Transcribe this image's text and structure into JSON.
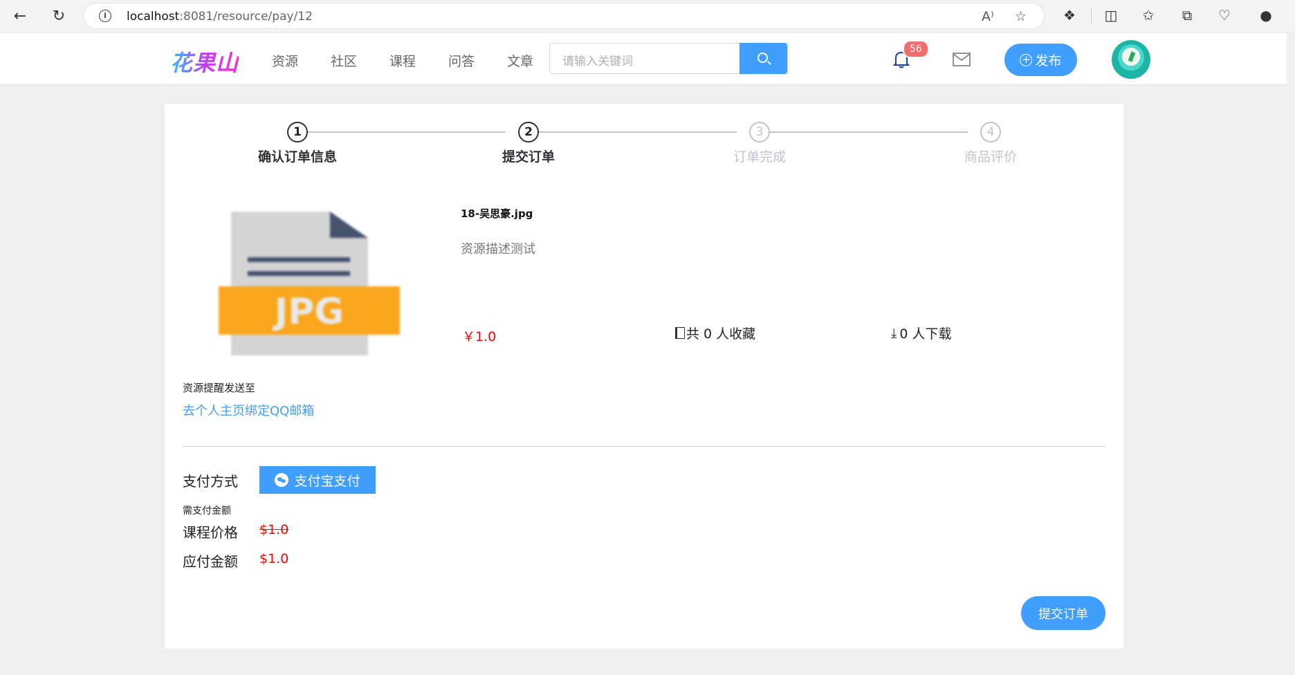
{
  "browser": {
    "url_host": "localhost",
    "url_rest": ":8081/resource/pay/12"
  },
  "header": {
    "logo": "花果山",
    "nav": [
      "资源",
      "社区",
      "课程",
      "问答",
      "文章"
    ],
    "search_placeholder": "请输入关键词",
    "notification_count": "56",
    "publish_label": "发布"
  },
  "steps": [
    {
      "num": "1",
      "label": "确认订单信息",
      "state": "done"
    },
    {
      "num": "2",
      "label": "提交订单",
      "state": "active"
    },
    {
      "num": "3",
      "label": "订单完成",
      "state": "pending"
    },
    {
      "num": "4",
      "label": "商品评价",
      "state": "pending"
    }
  ],
  "resource": {
    "thumb_text": "JPG",
    "title": "18-吴思豪.jpg",
    "description": "资源描述测试",
    "price": "￥1.0",
    "favorites": "共 0 人收藏",
    "downloads": "0 人下载"
  },
  "notify": {
    "label": "资源提醒发送至",
    "bind_link": "去个人主页绑定QQ邮箱"
  },
  "payment": {
    "method_label": "支付方式",
    "method_button": "支付宝支付",
    "need_pay_label": "需支付金额",
    "course_price_label": "课程价格",
    "course_price": "$1.0",
    "payable_label": "应付金额",
    "payable": "$1.0",
    "submit_label": "提交订单"
  },
  "colors": {
    "primary": "#409eff",
    "price_red": "#ff0000",
    "badge": "#f56c6c"
  }
}
